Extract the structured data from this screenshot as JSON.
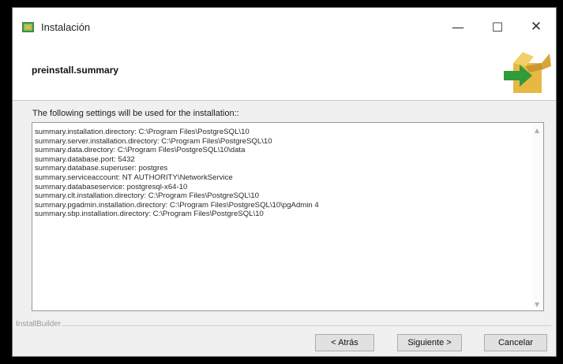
{
  "window": {
    "title": "Instalación",
    "minimize_glyph": "—",
    "maximize_glyph": "☐",
    "close_glyph": "✕",
    "icon": "installer-app-icon"
  },
  "header": {
    "title": "preinstall.summary",
    "icon": "open-box-arrow-icon"
  },
  "body": {
    "intro": "The following settings will be used for the installation::",
    "summary_lines": [
      "summary.installation.directory: C:\\Program Files\\PostgreSQL\\10",
      "summary.server.installation.directory: C:\\Program Files\\PostgreSQL\\10",
      "summary.data.directory: C:\\Program Files\\PostgreSQL\\10\\data",
      "summary.database.port: 5432",
      "summary.database.superuser: postgres",
      "summary.serviceaccount: NT AUTHORITY\\NetworkService",
      "summary.databaseservice: postgresql-x64-10",
      "summary.clt.installation.directory: C:\\Program Files\\PostgreSQL\\10",
      "summary.pgadmin.installation.directory: C:\\Program Files\\PostgreSQL\\10\\pgAdmin 4",
      "summary.sbp.installation.directory: C:\\Program Files\\PostgreSQL\\10"
    ]
  },
  "footer": {
    "brand": "InstallBuilder",
    "back_label": "< Atrás",
    "next_label": "Siguiente >",
    "cancel_label": "Cancelar"
  },
  "colors": {
    "outer_background": "#000000",
    "window_background": "#f0f0f0",
    "header_background": "#ffffff",
    "box_icon": "#e8b844",
    "arrow_icon": "#2f9b3a"
  }
}
